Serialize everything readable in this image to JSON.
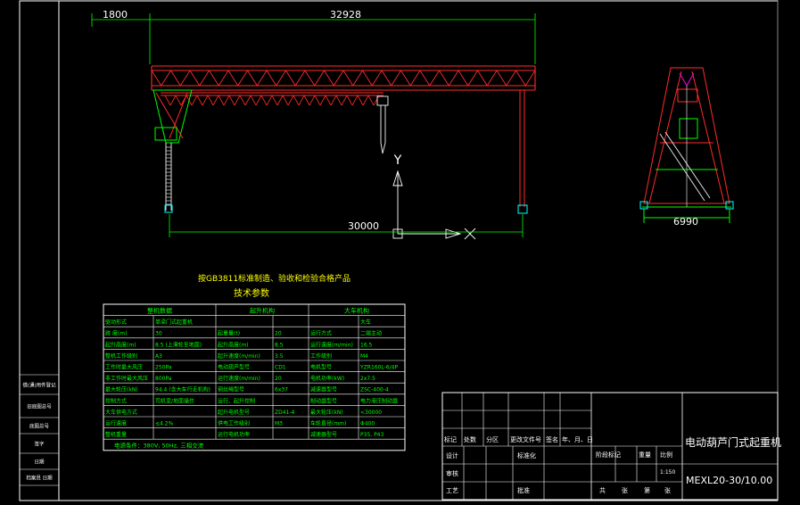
{
  "drawing": {
    "dimensions": {
      "left_overhang": "1800",
      "span_top": "32928",
      "rail_span": "30000",
      "side_width": "6990"
    },
    "axis": {
      "y": "Y",
      "x": "X"
    },
    "note": "按GB3811标准制造、验收和检验合格产品",
    "table_title": "技术参数"
  },
  "spec_table": {
    "headers": [
      "整机数据",
      "起升机构",
      "大车机构"
    ],
    "rows": [
      [
        "驱动形式",
        "单梁门式起重机",
        "",
        "",
        "",
        "大车"
      ],
      [
        "跨    度(m)",
        "30",
        "起重量(t)",
        "20",
        "运行方式",
        "二端主动"
      ],
      [
        "起升高度(m)",
        "8.5 (上滑轮至地面)",
        "起升高度(m)",
        "8.5",
        "运行速度(m/min)",
        "16.5"
      ],
      [
        "整机工作级别",
        "A3",
        "起升速度(m/min)",
        "3.5",
        "工作级别",
        "M4"
      ],
      [
        "工作时最大风压",
        "250Pa",
        "电动葫芦型号",
        "CD1",
        "电机型号",
        "YZR160L-6/4P"
      ],
      [
        "非工作时最大风压",
        "800Pa",
        "运行速度(m/min)",
        "20",
        "电机功率(kW)",
        "2x7.5"
      ],
      [
        "最大轮压(kN)",
        "94.4 (含大车行走机构)",
        "钢丝绳型号",
        "6x37",
        "减速器型号",
        "ZSC-400-4"
      ],
      [
        "控制方式",
        "司机室/地面操作",
        "运行、起升控制",
        "",
        "制动器型号",
        "电力液压制动器"
      ],
      [
        "大车供电方式",
        "",
        "起升电机型号",
        "ZD41-4",
        "最大轮压(kN)",
        "<30000"
      ],
      [
        "运行速度",
        "≤4.2%",
        "供电工作级别",
        "M3",
        "车轮直径(mm)",
        "Φ400"
      ],
      [
        "整机重量",
        "",
        "运行电机功率",
        "",
        "减速器型号",
        "P35, P43"
      ]
    ],
    "footer": "电源条件：380V, 50Hz, 三相交流"
  },
  "title_block": {
    "revision_headers": [
      "标记",
      "处数",
      "分区",
      "更改文件号",
      "签名",
      "年、月、日"
    ],
    "roles": [
      "设计",
      "标准化",
      "审核",
      "工艺",
      "批准"
    ],
    "stage_headers": [
      "阶段标记",
      "重量",
      "比例"
    ],
    "scale": "1:150",
    "sheet": [
      "共",
      "张",
      "第",
      "张"
    ],
    "drawing_name": "电动葫芦门式起重机",
    "drawing_code": "MEXL20-30/10.00"
  },
  "left_strip": {
    "labels": [
      "借(通)用件登记",
      "旧底图总号",
      "底图总号",
      "签字",
      "日期",
      "档案员 日期"
    ]
  }
}
